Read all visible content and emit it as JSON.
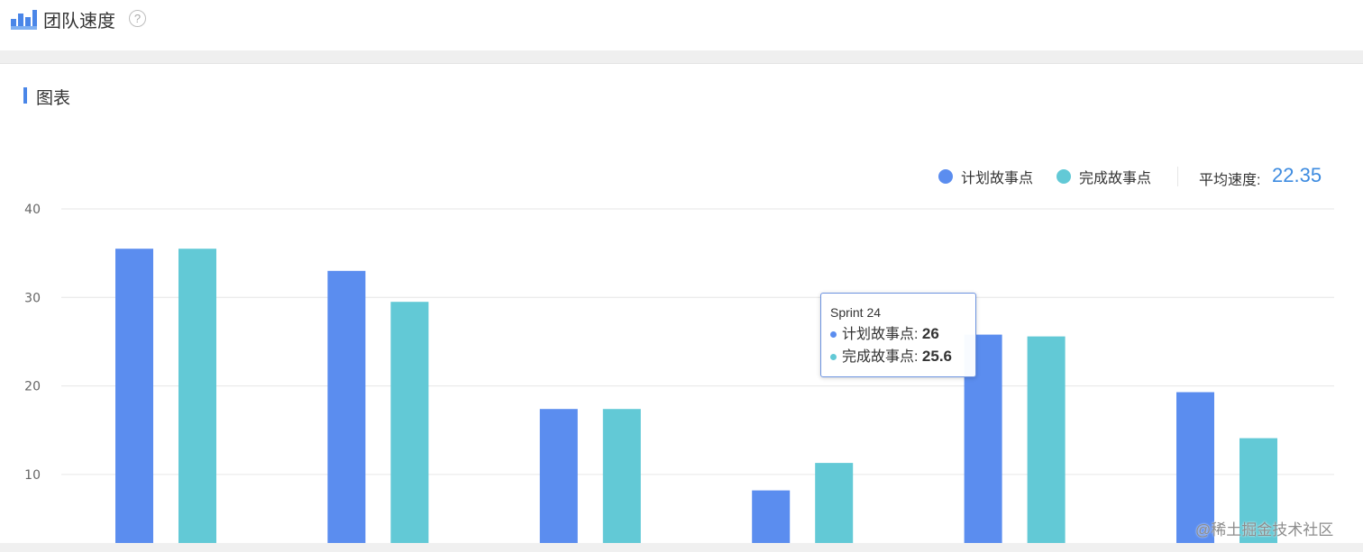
{
  "header": {
    "title": "团队速度",
    "help_glyph": "?"
  },
  "section": {
    "title": "图表"
  },
  "legend": {
    "planned": {
      "label": "计划故事点",
      "color": "#5b8def"
    },
    "completed": {
      "label": "完成故事点",
      "color": "#62c9d6"
    },
    "average_label": "平均速度:",
    "average_value": "22.35"
  },
  "tooltip": {
    "title": "Sprint 24",
    "rows": [
      {
        "label": "计划故事点: ",
        "value": "26",
        "color": "#5b8def"
      },
      {
        "label": "完成故事点: ",
        "value": "25.6",
        "color": "#62c9d6"
      }
    ]
  },
  "watermark": "@稀土掘金技术社区",
  "chart_data": {
    "type": "bar",
    "categories": [
      "",
      "",
      "",
      "",
      "",
      ""
    ],
    "series": [
      {
        "name": "计划故事点",
        "color": "#5b8def",
        "values": [
          35.5,
          33,
          17.4,
          8.2,
          25.8,
          19.3
        ]
      },
      {
        "name": "完成故事点",
        "color": "#62c9d6",
        "values": [
          35.5,
          29.5,
          17.4,
          11.3,
          25.6,
          14.1
        ]
      }
    ],
    "yticks": [
      10,
      20,
      30,
      40
    ],
    "ylim": [
      4,
      40
    ],
    "grid": true,
    "legend_position": "top-right"
  }
}
